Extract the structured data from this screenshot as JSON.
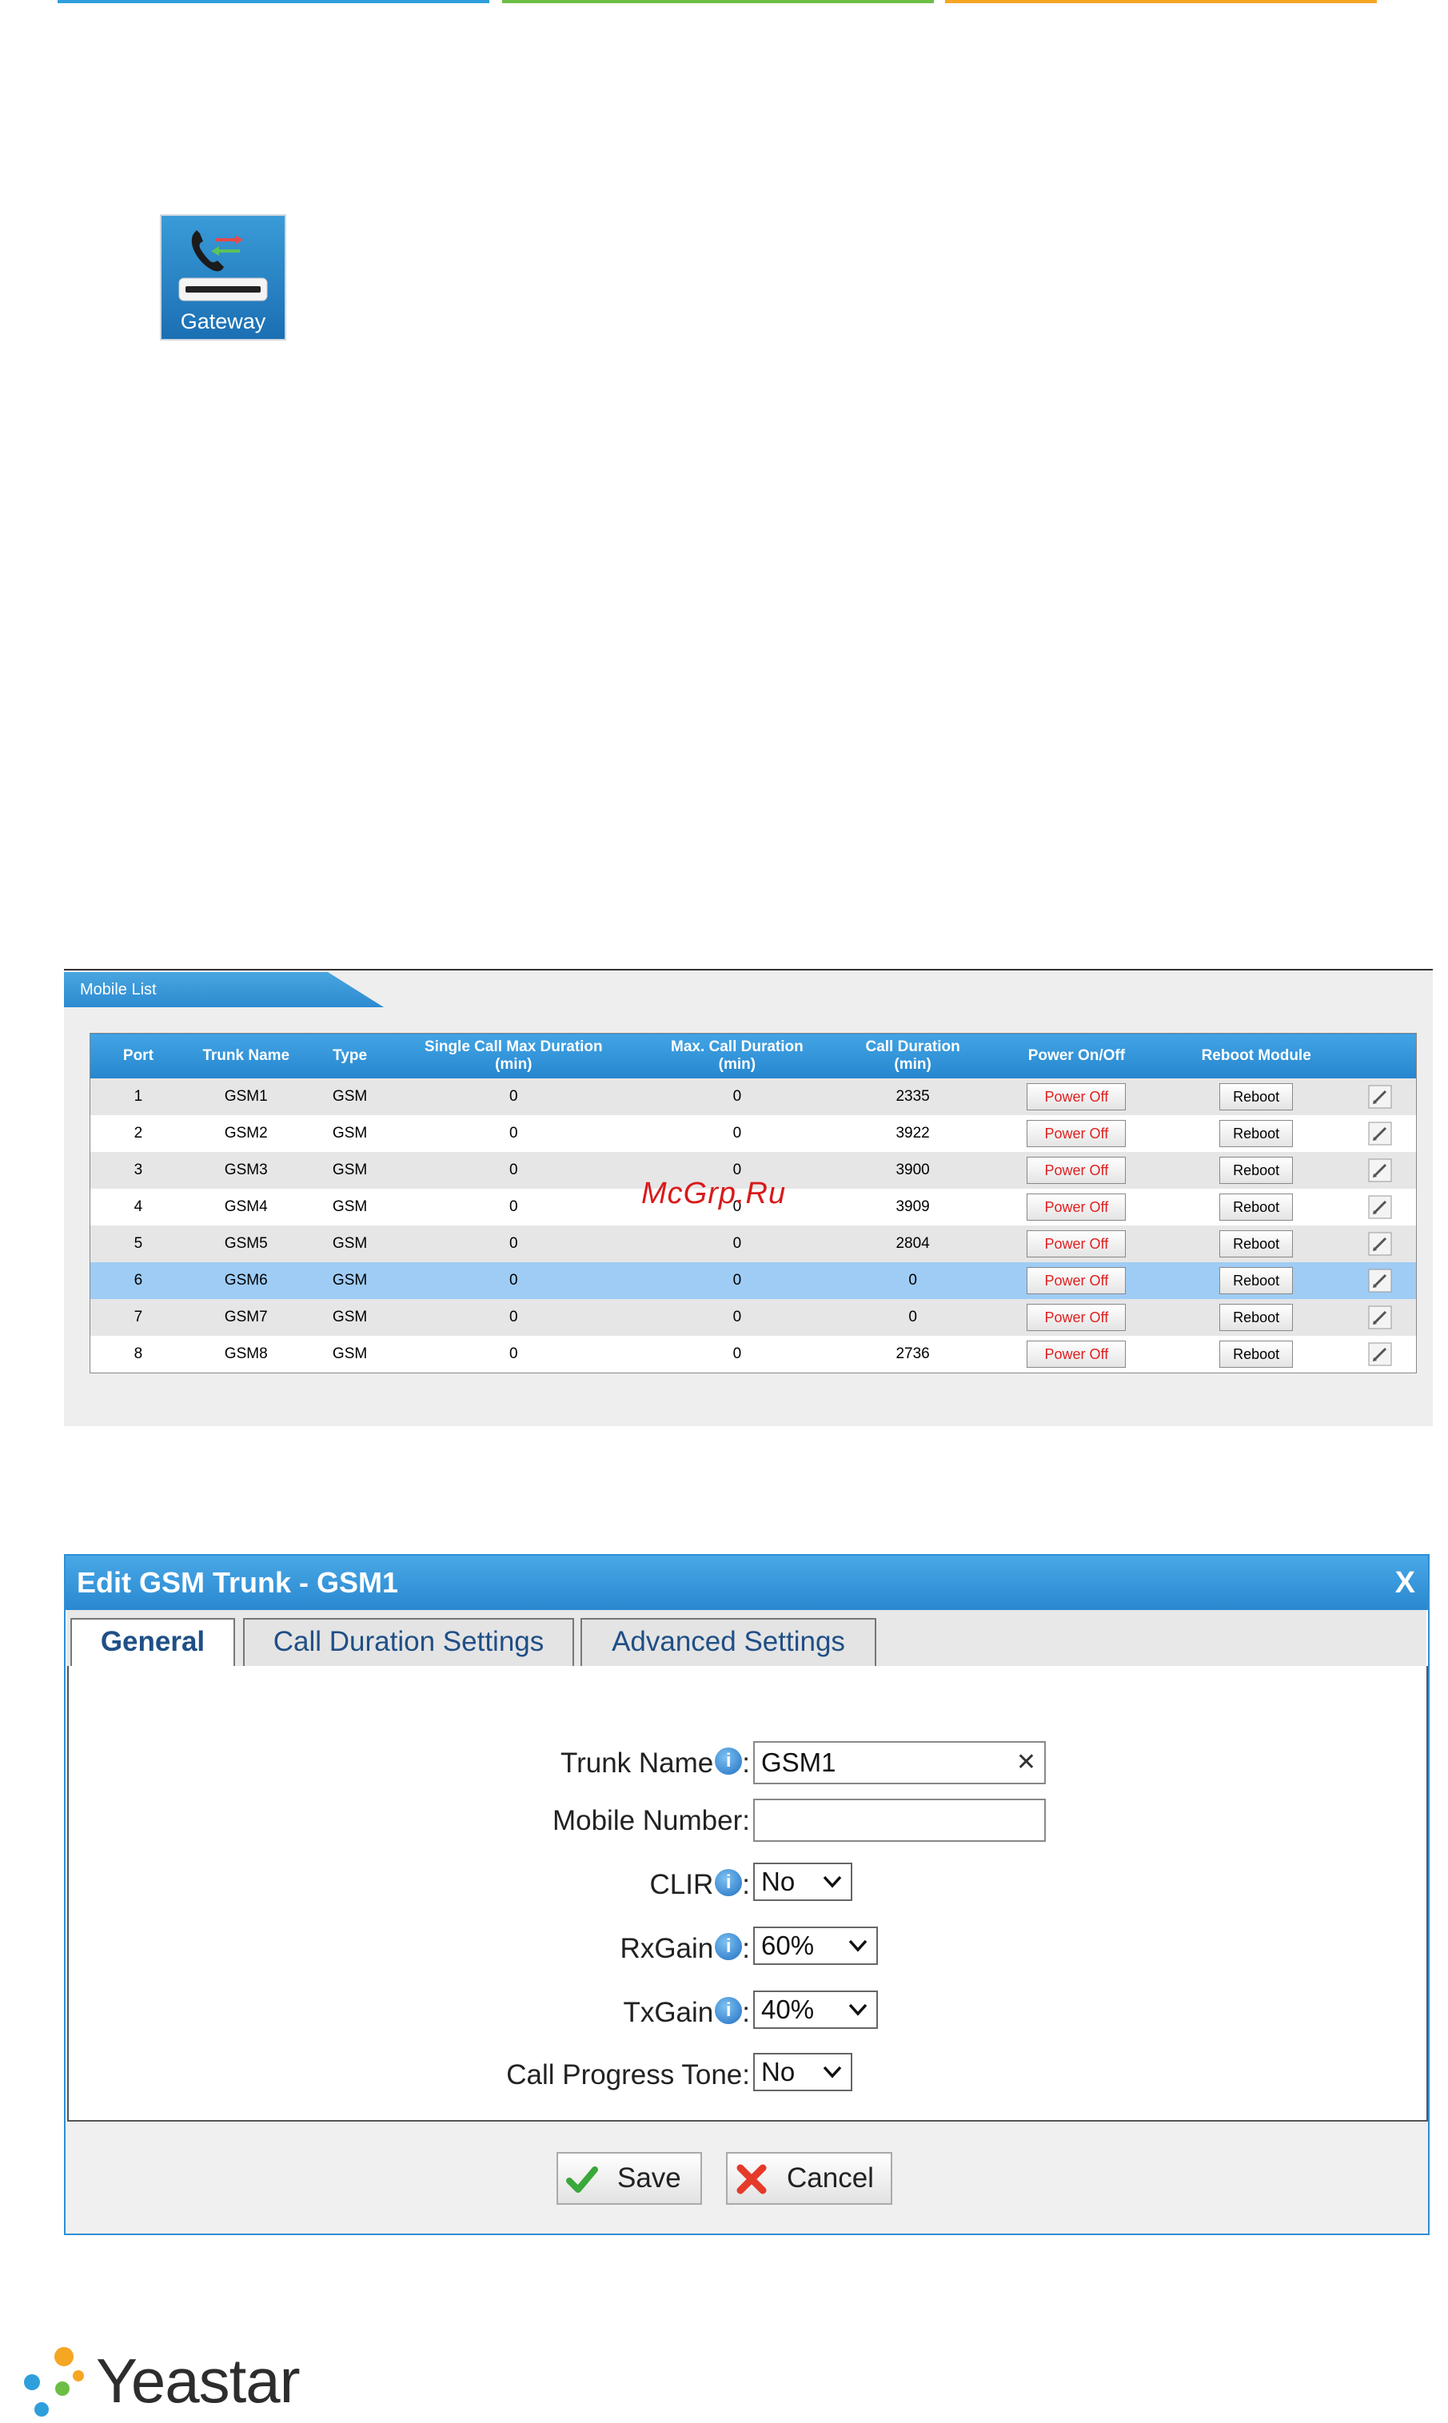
{
  "gateway_icon": {
    "label": "Gateway"
  },
  "mobile_list": {
    "tab_label": "Mobile List",
    "columns": [
      {
        "l1": "Port",
        "l2": ""
      },
      {
        "l1": "Trunk Name",
        "l2": ""
      },
      {
        "l1": "Type",
        "l2": ""
      },
      {
        "l1": "Single Call Max Duration",
        "l2": "(min)"
      },
      {
        "l1": "Max. Call Duration",
        "l2": "(min)"
      },
      {
        "l1": "Call Duration",
        "l2": "(min)"
      },
      {
        "l1": "Power On/Off",
        "l2": ""
      },
      {
        "l1": "Reboot Module",
        "l2": ""
      },
      {
        "l1": "",
        "l2": ""
      }
    ],
    "rows": [
      {
        "port": "1",
        "trunk": "GSM1",
        "type": "GSM",
        "single": "0",
        "max": "0",
        "dur": "2335",
        "power": "Power Off",
        "reboot": "Reboot"
      },
      {
        "port": "2",
        "trunk": "GSM2",
        "type": "GSM",
        "single": "0",
        "max": "0",
        "dur": "3922",
        "power": "Power Off",
        "reboot": "Reboot"
      },
      {
        "port": "3",
        "trunk": "GSM3",
        "type": "GSM",
        "single": "0",
        "max": "0",
        "dur": "3900",
        "power": "Power Off",
        "reboot": "Reboot"
      },
      {
        "port": "4",
        "trunk": "GSM4",
        "type": "GSM",
        "single": "0",
        "max": "0",
        "dur": "3909",
        "power": "Power Off",
        "reboot": "Reboot"
      },
      {
        "port": "5",
        "trunk": "GSM5",
        "type": "GSM",
        "single": "0",
        "max": "0",
        "dur": "2804",
        "power": "Power Off",
        "reboot": "Reboot"
      },
      {
        "port": "6",
        "trunk": "GSM6",
        "type": "GSM",
        "single": "0",
        "max": "0",
        "dur": "0",
        "power": "Power Off",
        "reboot": "Reboot"
      },
      {
        "port": "7",
        "trunk": "GSM7",
        "type": "GSM",
        "single": "0",
        "max": "0",
        "dur": "0",
        "power": "Power Off",
        "reboot": "Reboot"
      },
      {
        "port": "8",
        "trunk": "GSM8",
        "type": "GSM",
        "single": "0",
        "max": "0",
        "dur": "2736",
        "power": "Power Off",
        "reboot": "Reboot"
      }
    ],
    "selected_row": "6"
  },
  "watermark": "McGrp.Ru",
  "dialog": {
    "title": "Edit GSM Trunk - GSM1",
    "close": "X",
    "tabs": [
      "General",
      "Call Duration Settings",
      "Advanced Settings"
    ],
    "active_tab": "General",
    "fields": {
      "trunk_name_label": "Trunk Name",
      "trunk_name_value": "GSM1",
      "mobile_number_label": "Mobile Number",
      "mobile_number_value": "",
      "clir_label": "CLIR",
      "clir_value": "No",
      "rxgain_label": "RxGain",
      "rxgain_value": "60%",
      "txgain_label": "TxGain",
      "txgain_value": "40%",
      "cpt_label": "Call Progress Tone",
      "cpt_value": "No"
    },
    "save_label": "Save",
    "cancel_label": "Cancel"
  },
  "footer_logo": {
    "text": "Yeastar"
  },
  "colors": {
    "accent_blue": "#2c8ad0",
    "power_off_red": "#e02020",
    "selected_row": "#9fccf5"
  }
}
